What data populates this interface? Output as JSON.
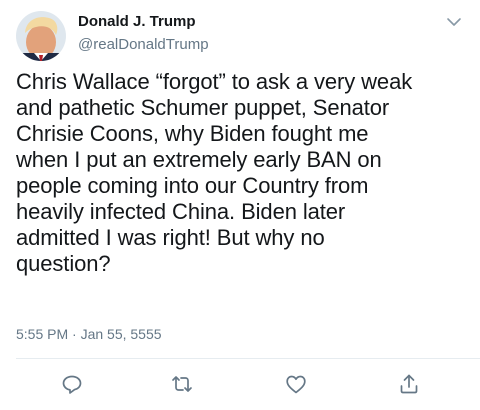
{
  "tweet": {
    "author_name": "Donald J. Trump",
    "author_handle": "@realDonaldTrump",
    "text": "Chris Wallace “forgot” to ask a very weak\nand pathetic Schumer puppet, Senator\nChrisie Coons, why Biden fought me\nwhen I put an extremely early BAN on\npeople coming into our Country from\nheavily infected China. Biden later\nadmitted I was right! But why no\nquestion?",
    "timestamp": "5:55 PM · Jan 55, 5555"
  },
  "icons": {
    "menu": "chevron-down-icon",
    "reply": "reply-icon",
    "retweet": "retweet-icon",
    "like": "heart-icon",
    "share": "share-icon"
  },
  "colors": {
    "text": "#14171a",
    "secondary": "#657786",
    "icon": "#657786",
    "divider": "#e6ecf0"
  }
}
